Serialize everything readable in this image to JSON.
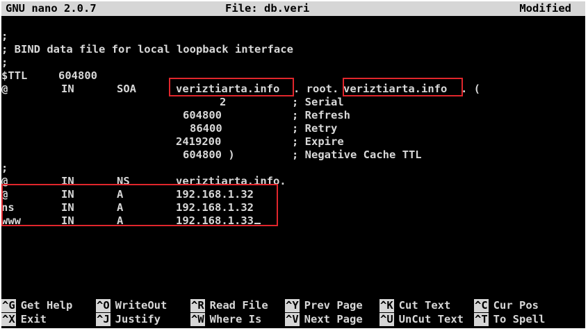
{
  "titlebar": {
    "app": "GNU nano 2.0.7",
    "file": "File: db.veri",
    "status": "Modified"
  },
  "lines": [
    [],
    [
      {
        "t": ";"
      }
    ],
    [
      {
        "t": "; BIND data file for local loopback interface"
      }
    ],
    [
      {
        "t": ";"
      }
    ],
    [
      {
        "t": "$TTL"
      },
      {
        "t": "604800"
      }
    ],
    [
      {
        "t": "@"
      },
      {
        "t": "IN"
      },
      {
        "t": "SOA"
      },
      {
        "t": "veriztiarta.info"
      },
      {
        "t": ". root."
      },
      {
        "t": "veriztiarta.info"
      },
      {
        "t": ". ("
      }
    ],
    [
      {
        "t": "2"
      },
      {
        "t": "; Serial"
      }
    ],
    [
      {
        "t": "604800"
      },
      {
        "t": "; Refresh"
      }
    ],
    [
      {
        "t": "86400"
      },
      {
        "t": "; Retry"
      }
    ],
    [
      {
        "t": "2419200"
      },
      {
        "t": "; Expire"
      }
    ],
    [
      {
        "t": "604800 )"
      },
      {
        "t": "; Negative Cache TTL"
      }
    ],
    [
      {
        "t": ";"
      }
    ],
    [
      {
        "t": "@"
      },
      {
        "t": "IN"
      },
      {
        "t": "NS"
      },
      {
        "t": "veriztiarta.info."
      }
    ],
    [
      {
        "t": "@"
      },
      {
        "t": "IN"
      },
      {
        "t": "A"
      },
      {
        "t": "192.168.1.32"
      }
    ],
    [
      {
        "t": "ns"
      },
      {
        "t": "IN"
      },
      {
        "t": "A"
      },
      {
        "t": "192.168.1.32"
      }
    ],
    [
      {
        "t": "www"
      },
      {
        "t": "IN"
      },
      {
        "t": "A"
      },
      {
        "t": "192.168.1.33"
      }
    ]
  ],
  "shortcuts": [
    {
      "key": "^G",
      "label": "Get Help"
    },
    {
      "key": "^O",
      "label": "WriteOut"
    },
    {
      "key": "^R",
      "label": "Read File"
    },
    {
      "key": "^Y",
      "label": "Prev Page"
    },
    {
      "key": "^K",
      "label": "Cut Text"
    },
    {
      "key": "^C",
      "label": "Cur Pos"
    },
    {
      "key": "^X",
      "label": "Exit"
    },
    {
      "key": "^J",
      "label": "Justify"
    },
    {
      "key": "^W",
      "label": "Where Is"
    },
    {
      "key": "^V",
      "label": "Next Page"
    },
    {
      "key": "^U",
      "label": "UnCut Text"
    },
    {
      "key": "^T",
      "label": "To Spell"
    }
  ],
  "colors": {
    "background": "#000000",
    "text": "#d8d8d8",
    "titlebar_bg": "#d6d6d6",
    "highlight_box": "#e0262c"
  }
}
